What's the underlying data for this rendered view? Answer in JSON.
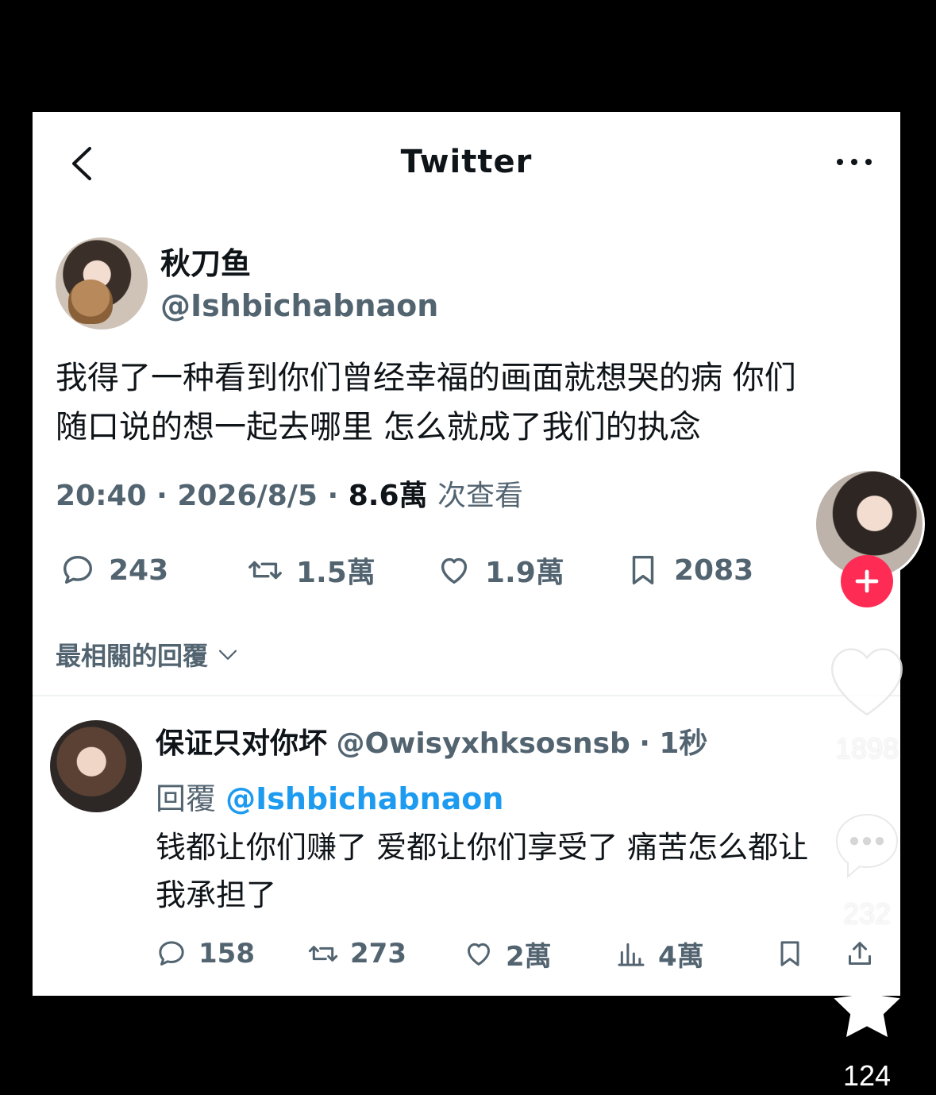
{
  "header": {
    "title": "Twitter"
  },
  "author": {
    "name": "秋刀鱼",
    "handle": "@Ishbichabnaon"
  },
  "tweet": {
    "text_line1": "我得了一种看到你们曾经幸福的画面就想哭的病 你们",
    "text_line2": "随口说的想一起去哪里 怎么就成了我们的执念",
    "time": "20:40",
    "date": "2026/8/5",
    "views": "8.6萬",
    "views_label": "次查看"
  },
  "stats": {
    "replies": "243",
    "retweets": "1.5萬",
    "likes": "1.9萬",
    "bookmarks": "2083"
  },
  "sort": {
    "label": "最相關的回覆"
  },
  "reply": {
    "name": "保证只对你坏",
    "handle": "@Owisyxhksosnsb",
    "time": "1秒",
    "reply_to_label": "回覆",
    "reply_to_handle": "@Ishbichabnaon",
    "text_line1": "钱都让你们赚了 爱都让你们享受了 痛苦怎么都让",
    "text_line2": "我承担了",
    "stats": {
      "replies": "158",
      "retweets": "273",
      "likes": "2萬",
      "views": "4萬"
    }
  },
  "overlay": {
    "likes": "1898",
    "comments": "232",
    "favorites": "124"
  },
  "colors": {
    "link": "#1d9bf0",
    "secondary": "#536471",
    "follow": "#fe2c55"
  }
}
